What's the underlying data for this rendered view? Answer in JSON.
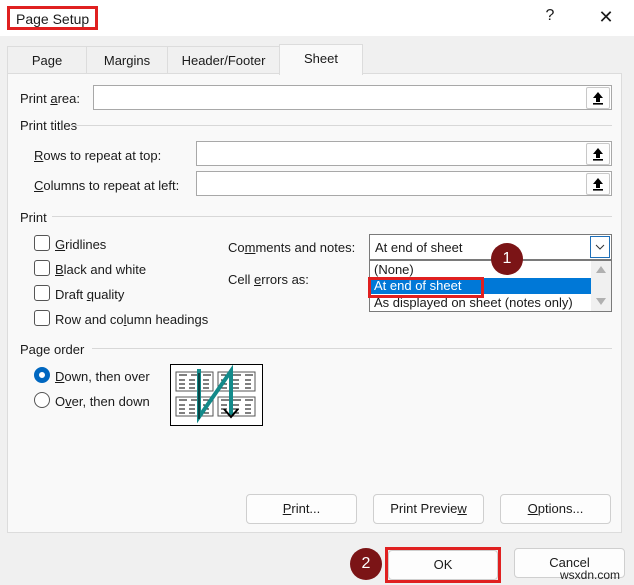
{
  "window": {
    "title": "Page Setup",
    "help_label": "?",
    "close_label": "✕"
  },
  "tabs": [
    {
      "label": "Page",
      "active": false
    },
    {
      "label": "Margins",
      "active": false
    },
    {
      "label": "Header/Footer",
      "active": false
    },
    {
      "label": "Sheet",
      "active": true
    }
  ],
  "print_area": {
    "label_pre": "Print ",
    "label_u": "a",
    "label_post": "rea:",
    "value": "",
    "ref_icon": "collapse-dialog-icon"
  },
  "print_titles": {
    "heading": "Print titles",
    "rows": {
      "label_u": "R",
      "label_post": "ows to repeat at top:",
      "value": ""
    },
    "cols": {
      "label_u": "C",
      "label_post": "olumns to repeat at left:",
      "value": ""
    }
  },
  "print": {
    "heading": "Print",
    "checkboxes": [
      {
        "pre": "",
        "u": "G",
        "post": "ridlines",
        "checked": false
      },
      {
        "pre": "",
        "u": "B",
        "post": "lack and white",
        "checked": false
      },
      {
        "pre": "Draft ",
        "u": "q",
        "post": "uality",
        "checked": false
      },
      {
        "pre": "Row and co",
        "u": "l",
        "post": "umn headings",
        "checked": false
      }
    ],
    "comments": {
      "label_pre": "Co",
      "label_u": "m",
      "label_post": "ments and notes:",
      "selected": "At end of sheet",
      "options": [
        "(None)",
        "At end of sheet",
        "As displayed on sheet (notes only)"
      ],
      "highlighted_index": 1
    },
    "cell_errors": {
      "label_pre": "Cell ",
      "label_u": "e",
      "label_post": "rrors as:"
    }
  },
  "page_order": {
    "heading": "Page order",
    "options": [
      {
        "u": "D",
        "post": "own, then over",
        "selected": true
      },
      {
        "pre": "O",
        "u": "v",
        "post": "er, then down",
        "selected": false
      }
    ]
  },
  "buttons": {
    "print": {
      "u": "P",
      "post": "rint..."
    },
    "preview": {
      "pre": "Print Previe",
      "u": "w"
    },
    "options": {
      "u": "O",
      "post": "ptions..."
    },
    "ok": "OK",
    "cancel": "Cancel"
  },
  "annotations": {
    "step1": "1",
    "step2": "2",
    "color": "#7b1416",
    "highlight_color": "#e02020"
  },
  "watermark": "wsxdn.com"
}
